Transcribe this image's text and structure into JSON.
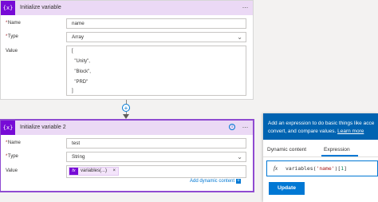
{
  "card1": {
    "icon_text": "{x}",
    "title": "Initialize variable",
    "more": "···",
    "name_label": "Name",
    "name_value": "name",
    "type_label": "Type",
    "type_value": "Array",
    "value_label": "Value",
    "value_lines": [
      "[",
      "  \"Unity\",",
      "  \"Block\",",
      "  \"PRD\"",
      "]"
    ]
  },
  "connector": {
    "plus": "+"
  },
  "card2": {
    "icon_text": "{x}",
    "title": "Initialize variable 2",
    "info": "i",
    "more": "···",
    "name_label": "Name",
    "name_value": "test",
    "type_label": "Type",
    "type_value": "String",
    "value_label": "Value",
    "token_fx": "fx",
    "token_label": "variables(...)",
    "token_remove": "×",
    "add_dynamic_label": "Add dynamic content",
    "add_dynamic_plus": "+"
  },
  "required_mark": "*",
  "expression_panel": {
    "header_line1": "Add an expression to do basic things like acce",
    "header_line2": "convert, and compare values.",
    "header_link": "Learn more",
    "tab_dynamic": "Dynamic content",
    "tab_expression": "Expression",
    "active_tab": "Expression",
    "fx_symbol": "fx",
    "expr_func": "variables(",
    "expr_arg": "'name'",
    "expr_close": ")[",
    "expr_index": "1",
    "expr_end": "]",
    "update_label": "Update"
  },
  "colors": {
    "accent": "#770bd6",
    "header_bg": "#ebd9f5",
    "panel_header": "#0063b1",
    "link": "#0078d4"
  }
}
